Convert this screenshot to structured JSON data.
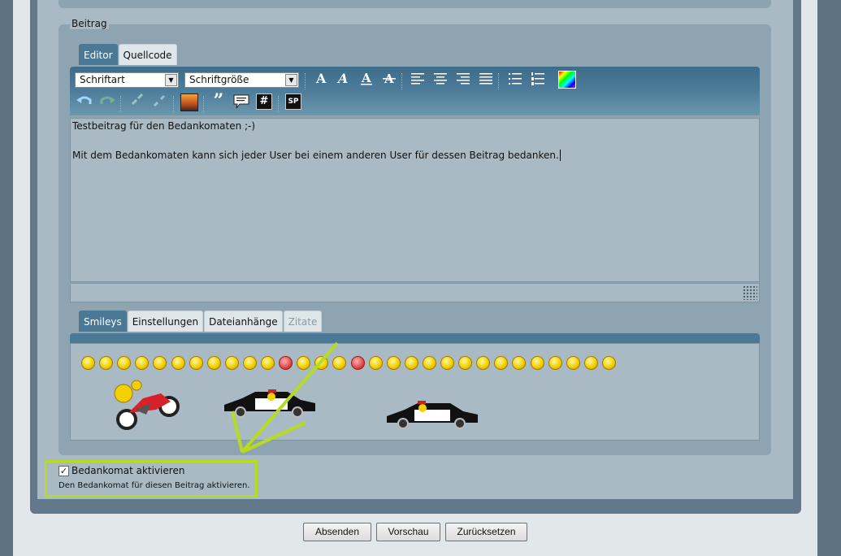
{
  "fieldset": {
    "legend": "Beitrag"
  },
  "editor_tabs": [
    {
      "label": "Editor"
    },
    {
      "label": "Quellcode"
    }
  ],
  "toolbar": {
    "font_select": "Schriftart",
    "size_select": "Schriftgröße",
    "row1_icons": [
      "bold-icon",
      "italic-icon",
      "underline-icon",
      "strikethrough-icon",
      "align-left-icon",
      "align-center-icon",
      "align-right-icon",
      "align-justify-icon",
      "bullet-list-icon",
      "numbered-list-icon",
      "color-picker-icon"
    ],
    "row2_icons": [
      "undo-icon",
      "redo-icon",
      "link-icon",
      "unlink-icon",
      "image-icon",
      "quote-icon",
      "speech-bubble-icon",
      "code-icon",
      "spoiler-icon"
    ],
    "quote_glyph": "”",
    "code_glyph": "#",
    "spoiler_glyph": "SP"
  },
  "editor": {
    "line1": "Testbeitrag für den Bedankomaten ;-)",
    "line2": "Mit dem Bedankomaten kann sich jeder User bei einem anderen User für dessen Beitrag bedanken."
  },
  "bottom_tabs": [
    {
      "label": "Smileys"
    },
    {
      "label": "Einstellungen"
    },
    {
      "label": "Dateianhänge"
    },
    {
      "label": "Zitate"
    }
  ],
  "smileys_count": 30,
  "checkbox": {
    "label": "Bedankomat aktivieren",
    "description": "Den Bedankomat für diesen Beitrag aktivieren.",
    "checked": true,
    "check_glyph": "✓"
  },
  "buttons": {
    "submit": "Absenden",
    "preview": "Vorschau",
    "reset": "Zurücksetzen"
  },
  "colors": {
    "highlight": "#b5dc20",
    "tab_active": "#4b7894"
  }
}
